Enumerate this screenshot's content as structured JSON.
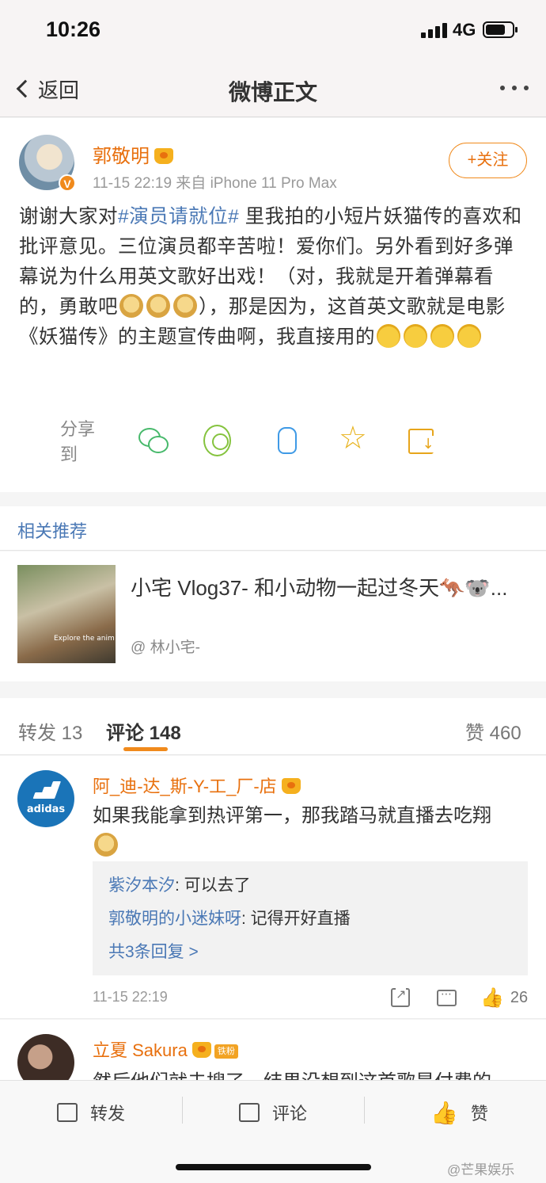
{
  "status_bar": {
    "time": "10:26",
    "network": "4G",
    "battery_level": 0.75
  },
  "nav": {
    "back_label": "返回",
    "title": "微博正文"
  },
  "post": {
    "author": "郭敬明",
    "meta": "11-15 22:19  来自 iPhone 11 Pro Max",
    "follow_label": "+关注",
    "verified_mark": "V",
    "text_parts": {
      "p1": "谢谢大家对",
      "topic": "#演员请就位#",
      "p2": " 里我拍的小短片妖猫传的喜欢和批评意见。三位演员都辛苦啦！爱你们。另外看到好多弹幕说为什么用英文歌好出戏！（对，我就是开着弹幕看的，勇敢吧",
      "p3": "），那是因为，这首英文歌就是电影《妖猫传》的主题宣传曲啊，我直接用的"
    },
    "share_label": "分享到"
  },
  "related": {
    "header": "相关推荐",
    "title": "小宅 Vlog37- 和小动物一起过冬天🦘🐨...",
    "author": "@ 林小宅-",
    "thumb_caption": "Explore the anim"
  },
  "tabs": {
    "repost": "转发 13",
    "comment": "评论 148",
    "like": "赞 460"
  },
  "comments": [
    {
      "name": "阿_迪-达_斯-Y-工_厂-店",
      "avatar_text": "adidas",
      "text": "如果我能拿到热评第一，那我踏马就直播去吃翔",
      "replies": [
        {
          "name": "紫汐本汐",
          "text": ": 可以去了"
        },
        {
          "name": "郭敬明的小迷妹呀",
          "text": ": 记得开好直播"
        }
      ],
      "more_replies": "共3条回复 >",
      "time": "11-15 22:19",
      "likes": "26"
    },
    {
      "name": "立夏 Sakura",
      "badge": "铁粉",
      "text": "然后他们就去搜了，结果没想到这首歌是付费的"
    }
  ],
  "bottom_bar": {
    "repost": "转发",
    "comment": "评论",
    "like": "赞"
  },
  "watermark": "@芒果娱乐"
}
